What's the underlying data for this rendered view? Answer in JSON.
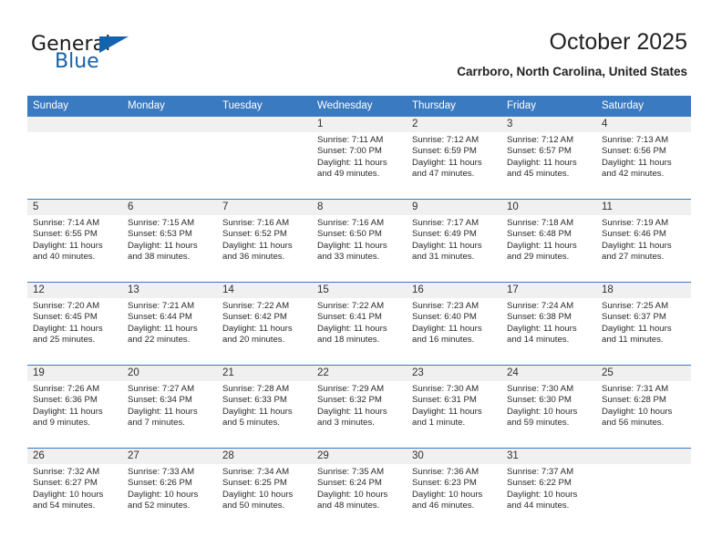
{
  "brand": {
    "name_part1": "General",
    "name_part2": "Blue"
  },
  "header": {
    "month_title": "October 2025",
    "location": "Carrboro, North Carolina, United States"
  },
  "colors": {
    "header_blue": "#3a7ac0",
    "brand_blue": "#1463ad",
    "daynum_strip": "#f0f0f0",
    "text": "#222222"
  },
  "weekday_headers": [
    "Sunday",
    "Monday",
    "Tuesday",
    "Wednesday",
    "Thursday",
    "Friday",
    "Saturday"
  ],
  "labels": {
    "sunrise_prefix": "Sunrise:",
    "sunset_prefix": "Sunset:",
    "daylight_prefix": "Daylight:"
  },
  "weeks": [
    [
      {
        "day": "",
        "sunrise": "",
        "sunset": "",
        "daylight_line1": "",
        "daylight_line2": ""
      },
      {
        "day": "",
        "sunrise": "",
        "sunset": "",
        "daylight_line1": "",
        "daylight_line2": ""
      },
      {
        "day": "",
        "sunrise": "",
        "sunset": "",
        "daylight_line1": "",
        "daylight_line2": ""
      },
      {
        "day": "1",
        "sunrise": "Sunrise: 7:11 AM",
        "sunset": "Sunset: 7:00 PM",
        "daylight_line1": "Daylight: 11 hours",
        "daylight_line2": "and 49 minutes."
      },
      {
        "day": "2",
        "sunrise": "Sunrise: 7:12 AM",
        "sunset": "Sunset: 6:59 PM",
        "daylight_line1": "Daylight: 11 hours",
        "daylight_line2": "and 47 minutes."
      },
      {
        "day": "3",
        "sunrise": "Sunrise: 7:12 AM",
        "sunset": "Sunset: 6:57 PM",
        "daylight_line1": "Daylight: 11 hours",
        "daylight_line2": "and 45 minutes."
      },
      {
        "day": "4",
        "sunrise": "Sunrise: 7:13 AM",
        "sunset": "Sunset: 6:56 PM",
        "daylight_line1": "Daylight: 11 hours",
        "daylight_line2": "and 42 minutes."
      }
    ],
    [
      {
        "day": "5",
        "sunrise": "Sunrise: 7:14 AM",
        "sunset": "Sunset: 6:55 PM",
        "daylight_line1": "Daylight: 11 hours",
        "daylight_line2": "and 40 minutes."
      },
      {
        "day": "6",
        "sunrise": "Sunrise: 7:15 AM",
        "sunset": "Sunset: 6:53 PM",
        "daylight_line1": "Daylight: 11 hours",
        "daylight_line2": "and 38 minutes."
      },
      {
        "day": "7",
        "sunrise": "Sunrise: 7:16 AM",
        "sunset": "Sunset: 6:52 PM",
        "daylight_line1": "Daylight: 11 hours",
        "daylight_line2": "and 36 minutes."
      },
      {
        "day": "8",
        "sunrise": "Sunrise: 7:16 AM",
        "sunset": "Sunset: 6:50 PM",
        "daylight_line1": "Daylight: 11 hours",
        "daylight_line2": "and 33 minutes."
      },
      {
        "day": "9",
        "sunrise": "Sunrise: 7:17 AM",
        "sunset": "Sunset: 6:49 PM",
        "daylight_line1": "Daylight: 11 hours",
        "daylight_line2": "and 31 minutes."
      },
      {
        "day": "10",
        "sunrise": "Sunrise: 7:18 AM",
        "sunset": "Sunset: 6:48 PM",
        "daylight_line1": "Daylight: 11 hours",
        "daylight_line2": "and 29 minutes."
      },
      {
        "day": "11",
        "sunrise": "Sunrise: 7:19 AM",
        "sunset": "Sunset: 6:46 PM",
        "daylight_line1": "Daylight: 11 hours",
        "daylight_line2": "and 27 minutes."
      }
    ],
    [
      {
        "day": "12",
        "sunrise": "Sunrise: 7:20 AM",
        "sunset": "Sunset: 6:45 PM",
        "daylight_line1": "Daylight: 11 hours",
        "daylight_line2": "and 25 minutes."
      },
      {
        "day": "13",
        "sunrise": "Sunrise: 7:21 AM",
        "sunset": "Sunset: 6:44 PM",
        "daylight_line1": "Daylight: 11 hours",
        "daylight_line2": "and 22 minutes."
      },
      {
        "day": "14",
        "sunrise": "Sunrise: 7:22 AM",
        "sunset": "Sunset: 6:42 PM",
        "daylight_line1": "Daylight: 11 hours",
        "daylight_line2": "and 20 minutes."
      },
      {
        "day": "15",
        "sunrise": "Sunrise: 7:22 AM",
        "sunset": "Sunset: 6:41 PM",
        "daylight_line1": "Daylight: 11 hours",
        "daylight_line2": "and 18 minutes."
      },
      {
        "day": "16",
        "sunrise": "Sunrise: 7:23 AM",
        "sunset": "Sunset: 6:40 PM",
        "daylight_line1": "Daylight: 11 hours",
        "daylight_line2": "and 16 minutes."
      },
      {
        "day": "17",
        "sunrise": "Sunrise: 7:24 AM",
        "sunset": "Sunset: 6:38 PM",
        "daylight_line1": "Daylight: 11 hours",
        "daylight_line2": "and 14 minutes."
      },
      {
        "day": "18",
        "sunrise": "Sunrise: 7:25 AM",
        "sunset": "Sunset: 6:37 PM",
        "daylight_line1": "Daylight: 11 hours",
        "daylight_line2": "and 11 minutes."
      }
    ],
    [
      {
        "day": "19",
        "sunrise": "Sunrise: 7:26 AM",
        "sunset": "Sunset: 6:36 PM",
        "daylight_line1": "Daylight: 11 hours",
        "daylight_line2": "and 9 minutes."
      },
      {
        "day": "20",
        "sunrise": "Sunrise: 7:27 AM",
        "sunset": "Sunset: 6:34 PM",
        "daylight_line1": "Daylight: 11 hours",
        "daylight_line2": "and 7 minutes."
      },
      {
        "day": "21",
        "sunrise": "Sunrise: 7:28 AM",
        "sunset": "Sunset: 6:33 PM",
        "daylight_line1": "Daylight: 11 hours",
        "daylight_line2": "and 5 minutes."
      },
      {
        "day": "22",
        "sunrise": "Sunrise: 7:29 AM",
        "sunset": "Sunset: 6:32 PM",
        "daylight_line1": "Daylight: 11 hours",
        "daylight_line2": "and 3 minutes."
      },
      {
        "day": "23",
        "sunrise": "Sunrise: 7:30 AM",
        "sunset": "Sunset: 6:31 PM",
        "daylight_line1": "Daylight: 11 hours",
        "daylight_line2": "and 1 minute."
      },
      {
        "day": "24",
        "sunrise": "Sunrise: 7:30 AM",
        "sunset": "Sunset: 6:30 PM",
        "daylight_line1": "Daylight: 10 hours",
        "daylight_line2": "and 59 minutes."
      },
      {
        "day": "25",
        "sunrise": "Sunrise: 7:31 AM",
        "sunset": "Sunset: 6:28 PM",
        "daylight_line1": "Daylight: 10 hours",
        "daylight_line2": "and 56 minutes."
      }
    ],
    [
      {
        "day": "26",
        "sunrise": "Sunrise: 7:32 AM",
        "sunset": "Sunset: 6:27 PM",
        "daylight_line1": "Daylight: 10 hours",
        "daylight_line2": "and 54 minutes."
      },
      {
        "day": "27",
        "sunrise": "Sunrise: 7:33 AM",
        "sunset": "Sunset: 6:26 PM",
        "daylight_line1": "Daylight: 10 hours",
        "daylight_line2": "and 52 minutes."
      },
      {
        "day": "28",
        "sunrise": "Sunrise: 7:34 AM",
        "sunset": "Sunset: 6:25 PM",
        "daylight_line1": "Daylight: 10 hours",
        "daylight_line2": "and 50 minutes."
      },
      {
        "day": "29",
        "sunrise": "Sunrise: 7:35 AM",
        "sunset": "Sunset: 6:24 PM",
        "daylight_line1": "Daylight: 10 hours",
        "daylight_line2": "and 48 minutes."
      },
      {
        "day": "30",
        "sunrise": "Sunrise: 7:36 AM",
        "sunset": "Sunset: 6:23 PM",
        "daylight_line1": "Daylight: 10 hours",
        "daylight_line2": "and 46 minutes."
      },
      {
        "day": "31",
        "sunrise": "Sunrise: 7:37 AM",
        "sunset": "Sunset: 6:22 PM",
        "daylight_line1": "Daylight: 10 hours",
        "daylight_line2": "and 44 minutes."
      },
      {
        "day": "",
        "sunrise": "",
        "sunset": "",
        "daylight_line1": "",
        "daylight_line2": ""
      }
    ]
  ]
}
